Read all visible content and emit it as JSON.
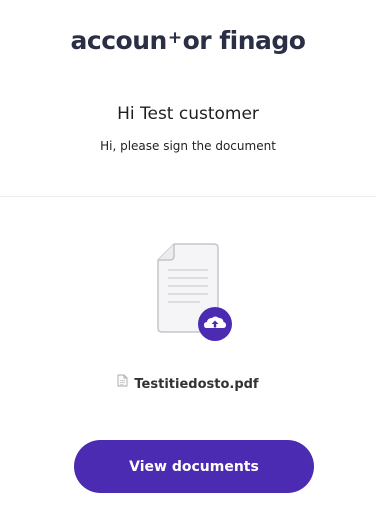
{
  "brand": {
    "logo_part1": "accoun",
    "logo_tee": "+",
    "logo_part2": "or finago"
  },
  "header": {
    "greeting": "Hi Test customer",
    "subtext": "Hi, please sign the document"
  },
  "document": {
    "icon": "document-with-upload-icon",
    "file_icon": "file-icon",
    "file_name": "Testitiedosto.pdf"
  },
  "actions": {
    "view_documents_label": "View documents"
  },
  "colors": {
    "brand_text": "#2b2f45",
    "accent": "#4b2bb1"
  }
}
